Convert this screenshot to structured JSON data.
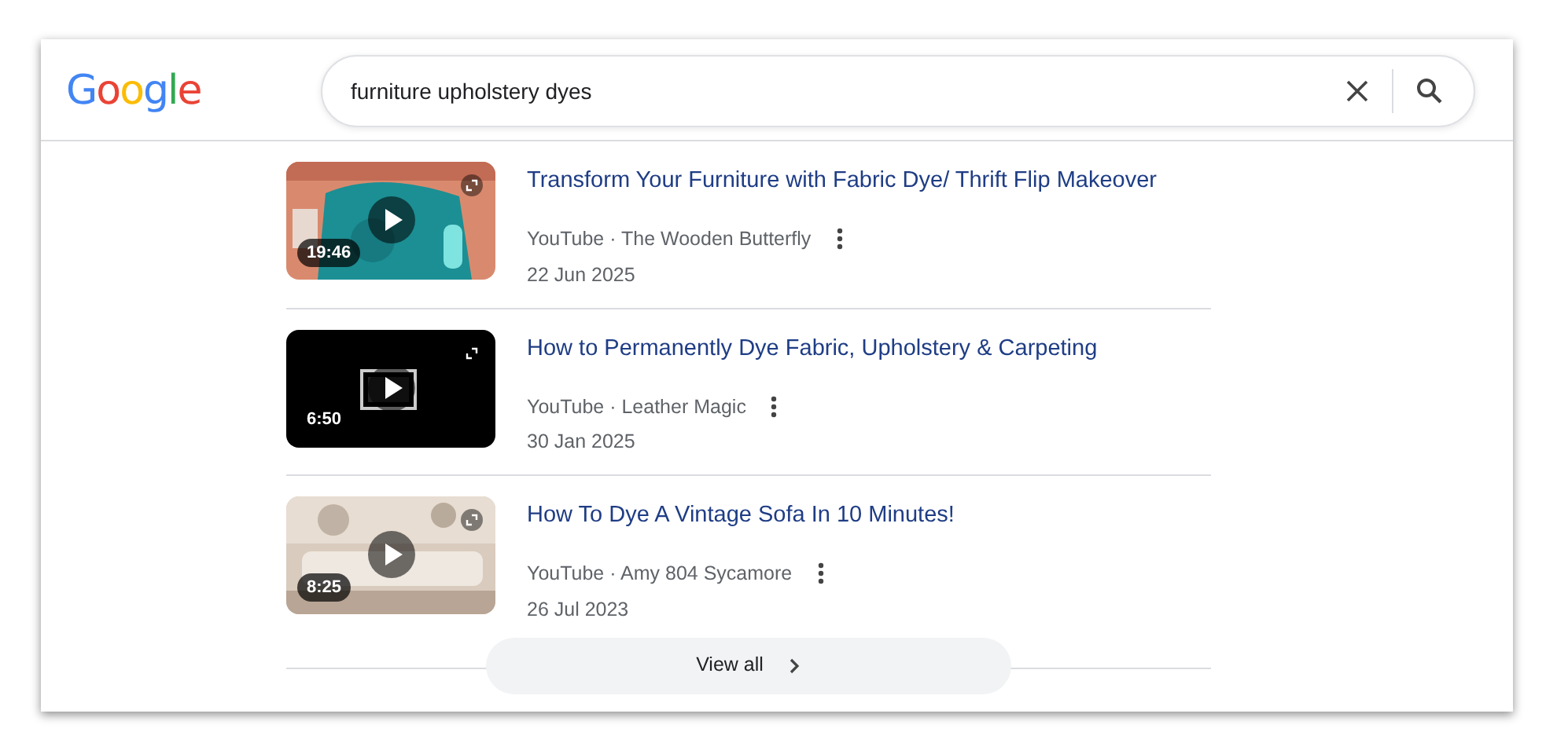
{
  "logo": "Google",
  "search": {
    "value": "furniture upholstery dyes"
  },
  "videos": [
    {
      "title": "Transform Your Furniture with Fabric Dye/ Thrift Flip Makeover",
      "source": "YouTube · The Wooden Butterfly",
      "date": "22 Jun 2025",
      "duration": "19:46"
    },
    {
      "title": "How to Permanently Dye Fabric, Upholstery & Carpeting",
      "source": "YouTube · Leather Magic",
      "date": "30 Jan 2025",
      "duration": "6:50"
    },
    {
      "title": "How To Dye A Vintage Sofa In 10 Minutes!",
      "source": "YouTube · Amy 804 Sycamore",
      "date": "26 Jul 2023",
      "duration": "8:25"
    }
  ],
  "view_all": "View all"
}
